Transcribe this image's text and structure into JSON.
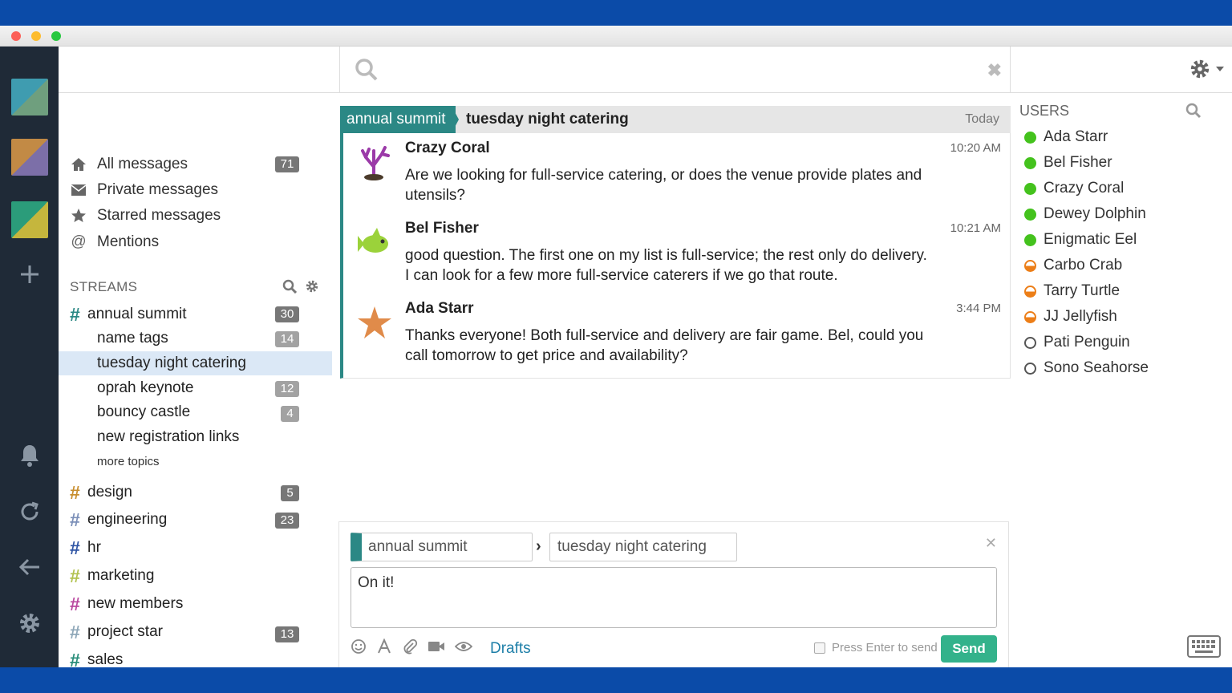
{
  "left_nav": [
    {
      "label": "All messages",
      "icon": "home-icon",
      "count": "71"
    },
    {
      "label": "Private messages",
      "icon": "envelope-icon",
      "count": ""
    },
    {
      "label": "Starred messages",
      "icon": "star-icon",
      "count": ""
    },
    {
      "label": "Mentions",
      "icon": "at-icon",
      "count": ""
    }
  ],
  "streams_header": "STREAMS",
  "streams": [
    {
      "name": "annual summit",
      "color": "#2b8885",
      "count": "30"
    },
    {
      "name": "design",
      "color": "#c88e2e",
      "count": "5"
    },
    {
      "name": "engineering",
      "color": "#7b8fb8",
      "count": "23"
    },
    {
      "name": "hr",
      "color": "#2f55a4",
      "count": ""
    },
    {
      "name": "marketing",
      "color": "#b2c24f",
      "count": ""
    },
    {
      "name": "new members",
      "color": "#b9479f",
      "count": ""
    },
    {
      "name": "project star",
      "color": "#8ea7b8",
      "count": "13"
    },
    {
      "name": "sales",
      "color": "#2a8d7a",
      "count": ""
    }
  ],
  "topics": [
    {
      "name": "name tags",
      "count": "14"
    },
    {
      "name": "tuesday night catering",
      "count": ""
    },
    {
      "name": "oprah keynote",
      "count": "12"
    },
    {
      "name": "bouncy castle",
      "count": "4"
    },
    {
      "name": "new registration links",
      "count": ""
    }
  ],
  "more_topics": "more topics",
  "recipient": {
    "stream": "annual summit",
    "topic": "tuesday night catering",
    "date": "Today"
  },
  "messages": [
    {
      "sender": "Crazy Coral",
      "time": "10:20 AM",
      "content": "Are we looking for full-service catering, or does the venue provide plates and utensils?"
    },
    {
      "sender": "Bel Fisher",
      "time": "10:21 AM",
      "content": "good question. The first one on my list is full-service; the rest only do delivery. I can look for a few more full-service caterers if we go that route."
    },
    {
      "sender": "Ada Starr",
      "time": "3:44 PM",
      "content": "Thanks everyone! Both full-service and delivery are fair game. Bel, could you call tomorrow to get price and availability?"
    }
  ],
  "compose": {
    "stream": "annual summit",
    "topic": "tuesday night catering",
    "text": "On it!",
    "drafts": "Drafts",
    "enter_to_send": "Press Enter to send",
    "send": "Send"
  },
  "users_header": "USERS",
  "users": [
    {
      "name": "Ada Starr",
      "status": "active"
    },
    {
      "name": "Bel Fisher",
      "status": "active"
    },
    {
      "name": "Crazy Coral",
      "status": "active"
    },
    {
      "name": "Dewey Dolphin",
      "status": "active"
    },
    {
      "name": "Enigmatic Eel",
      "status": "active"
    },
    {
      "name": "Carbo Crab",
      "status": "idle"
    },
    {
      "name": "Tarry Turtle",
      "status": "idle"
    },
    {
      "name": "JJ Jellyfish",
      "status": "idle"
    },
    {
      "name": "Pati Penguin",
      "status": "offline"
    },
    {
      "name": "Sono Seahorse",
      "status": "offline"
    }
  ],
  "colors": {
    "accent": "#2b8885",
    "send": "#33b28b",
    "frame": "#0b4ba8",
    "rail": "#1f2a37"
  }
}
